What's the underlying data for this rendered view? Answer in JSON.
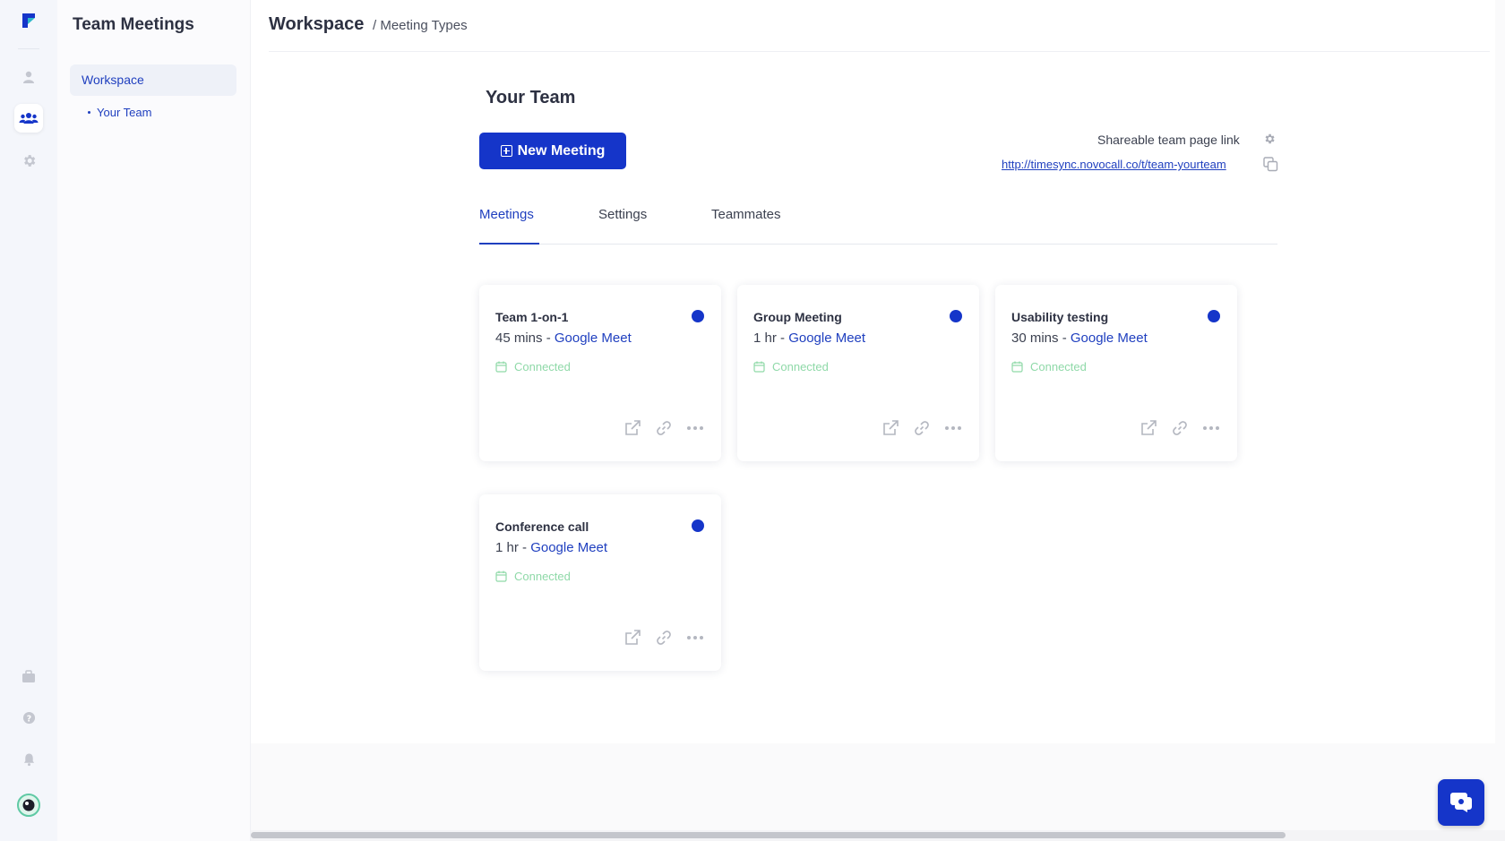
{
  "sidebar": {
    "title": "Team Meetings",
    "workspace_label": "Workspace",
    "sub_items": [
      "Your Team"
    ]
  },
  "header": {
    "crumb_main": "Workspace",
    "crumb_rest": "/ Meeting Types"
  },
  "main": {
    "section_title": "Your Team",
    "new_button_label": "New Meeting",
    "share_label": "Shareable team page link",
    "share_link": "http://timesync.novocall.co/t/team-yourteam",
    "tabs": [
      {
        "label": "Meetings",
        "active": true
      },
      {
        "label": "Settings",
        "active": false
      },
      {
        "label": "Teammates",
        "active": false
      }
    ]
  },
  "cards": [
    {
      "title": "Team 1-on-1",
      "duration": "45 mins -",
      "platform": "Google Meet",
      "status": "Connected"
    },
    {
      "title": "Group Meeting",
      "duration": "1 hr -",
      "platform": "Google Meet",
      "status": "Connected"
    },
    {
      "title": "Usability testing",
      "duration": "30 mins -",
      "platform": "Google Meet",
      "status": "Connected"
    },
    {
      "title": "Conference call",
      "duration": "1 hr -",
      "platform": "Google Meet",
      "status": "Connected"
    }
  ],
  "colors": {
    "accent": "#1535c9",
    "link": "#1f3fbf",
    "connected": "#8fd9a8",
    "icon_muted": "#c4c7d0"
  },
  "icons": {
    "rail": [
      "logo-icon",
      "user-icon",
      "team-icon",
      "gear-icon",
      "briefcase-icon",
      "help-icon",
      "bell-icon",
      "avatar"
    ],
    "card_actions": [
      "external-link-icon",
      "link-icon",
      "more-icon"
    ]
  }
}
